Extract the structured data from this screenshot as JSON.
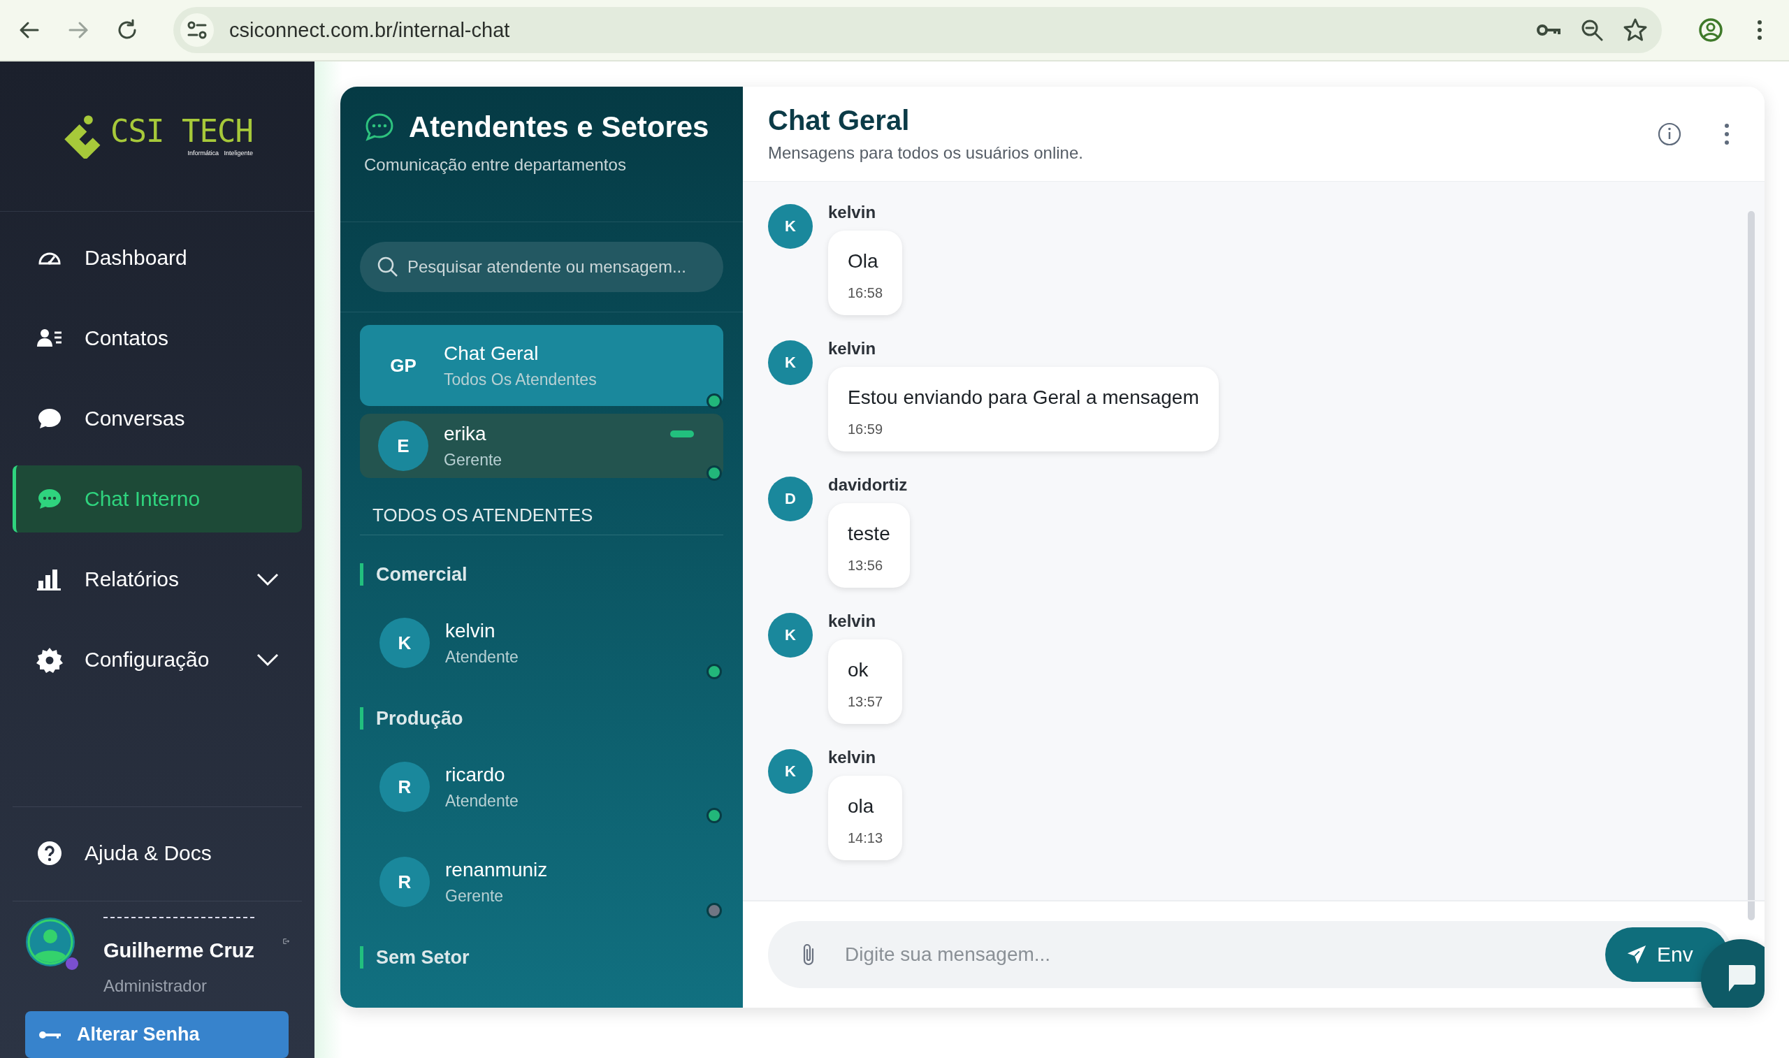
{
  "browser": {
    "url": "csiconnect.com.br/internal-chat"
  },
  "sidebar": {
    "logo": {
      "text": "CSI TECH",
      "tagline": "Informática   Inteligente"
    },
    "nav": [
      {
        "label": "Dashboard",
        "selected": false,
        "expandable": false
      },
      {
        "label": "Contatos",
        "selected": false,
        "expandable": false
      },
      {
        "label": "Conversas",
        "selected": false,
        "expandable": false
      },
      {
        "label": "Chat Interno",
        "selected": true,
        "expandable": false
      },
      {
        "label": "Relatórios",
        "selected": false,
        "expandable": true
      },
      {
        "label": "Configuração",
        "selected": false,
        "expandable": true
      }
    ],
    "help": {
      "label": "Ajuda & Docs"
    },
    "user": {
      "name": "Guilherme Cruz",
      "role": "Administrador"
    },
    "change_password": {
      "label": "Alterar Senha"
    }
  },
  "chat_list": {
    "title": "Atendentes e Setores",
    "subtitle": "Comunicação entre departamentos",
    "search": {
      "placeholder": "Pesquisar atendente ou mensagem..."
    },
    "pinned": [
      {
        "kind": "group",
        "initials": "GP",
        "name": "Chat Geral",
        "subtitle": "Todos Os Atendentes",
        "selected": true,
        "online": true,
        "unread": false
      },
      {
        "kind": "user",
        "initials": "E",
        "name": "erika",
        "subtitle": "Gerente",
        "selected": false,
        "online": true,
        "unread": true
      }
    ],
    "section_label": "TODOS OS ATENDENTES",
    "sectors": [
      {
        "name": "Comercial",
        "members": [
          {
            "initials": "K",
            "name": "kelvin",
            "role": "Atendente",
            "online": true
          }
        ]
      },
      {
        "name": "Produção",
        "members": [
          {
            "initials": "R",
            "name": "ricardo",
            "role": "Atendente",
            "online": true
          },
          {
            "initials": "R",
            "name": "renanmuniz",
            "role": "Gerente",
            "online": false
          }
        ]
      },
      {
        "name": "Sem Setor"
      }
    ]
  },
  "chat": {
    "title": "Chat Geral",
    "subtitle": "Mensagens para todos os usuários online.",
    "messages": [
      {
        "initial": "K",
        "sender": "kelvin",
        "text": "Ola",
        "time": "16:58"
      },
      {
        "initial": "K",
        "sender": "kelvin",
        "text": "Estou enviando para Geral a mensagem",
        "time": "16:59"
      },
      {
        "initial": "D",
        "sender": "davidortiz",
        "text": "teste",
        "time": "13:56"
      },
      {
        "initial": "K",
        "sender": "kelvin",
        "text": "ok",
        "time": "13:57"
      },
      {
        "initial": "K",
        "sender": "kelvin",
        "text": "ola",
        "time": "14:13"
      }
    ],
    "input": {
      "placeholder": "Digite sua mensagem..."
    },
    "send": {
      "label": "Env"
    }
  }
}
